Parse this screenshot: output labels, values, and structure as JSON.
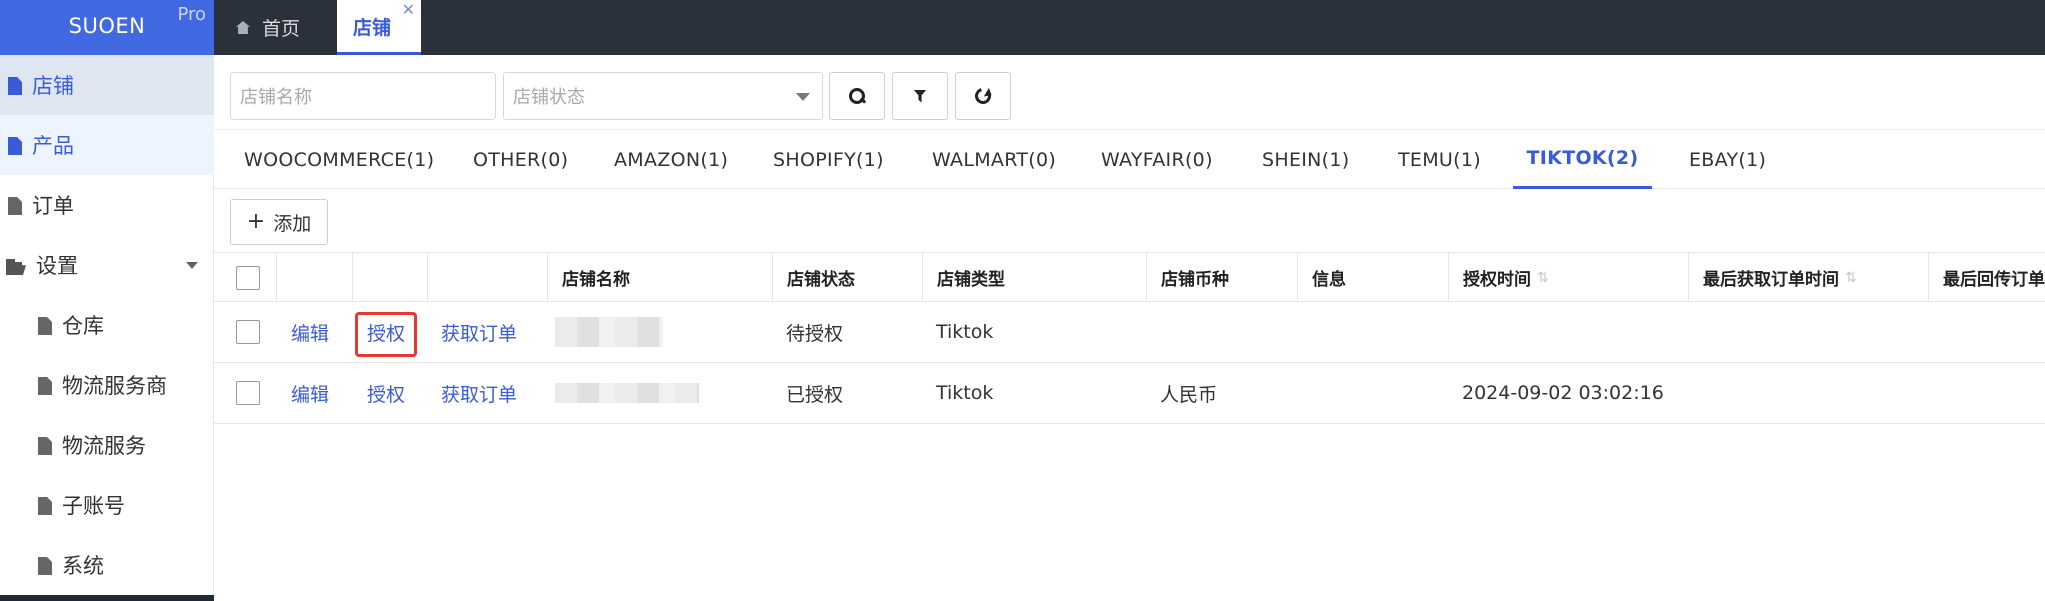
{
  "brand": {
    "name": "SUOEN",
    "badge": "Pro"
  },
  "sidebar": {
    "items": [
      {
        "label": "店铺"
      },
      {
        "label": "产品"
      },
      {
        "label": "订单"
      },
      {
        "label": "设置"
      },
      {
        "label": "仓库"
      },
      {
        "label": "物流服务商"
      },
      {
        "label": "物流服务"
      },
      {
        "label": "子账号"
      },
      {
        "label": "系统"
      }
    ]
  },
  "tabs": {
    "home": "首页",
    "shop": "店铺",
    "close": "✕"
  },
  "toolbar": {
    "name_placeholder": "店铺名称",
    "status_placeholder": "店铺状态"
  },
  "platform_tabs": [
    "WOOCOMMERCE(1)",
    "OTHER(0)",
    "AMAZON(1)",
    "SHOPIFY(1)",
    "WALMART(0)",
    "WAYFAIR(0)",
    "SHEIN(1)",
    "TEMU(1)",
    "TIKTOK(2)",
    "EBAY(1)"
  ],
  "add_label": "添加",
  "table": {
    "columns": [
      "店铺名称",
      "店铺状态",
      "店铺类型",
      "店铺币种",
      "信息",
      "授权时间",
      "最后获取订单时间",
      "最后回传订单时"
    ],
    "sort_glyph": "⇅",
    "rows": [
      {
        "edit": "编辑",
        "auth": "授权",
        "fetch": "获取订单",
        "status": "待授权",
        "type": "Tiktok",
        "currency": "",
        "info": "",
        "auth_time": ""
      },
      {
        "edit": "编辑",
        "auth": "授权",
        "fetch": "获取订单",
        "status": "已授权",
        "type": "Tiktok",
        "currency": "人民币",
        "info": "",
        "auth_time": "2024-09-02 03:02:16"
      }
    ]
  },
  "colors": {
    "accent": "#3a5bd9",
    "brand": "#4169e1",
    "topbar": "#2a313b",
    "highlight": "#e53935"
  }
}
